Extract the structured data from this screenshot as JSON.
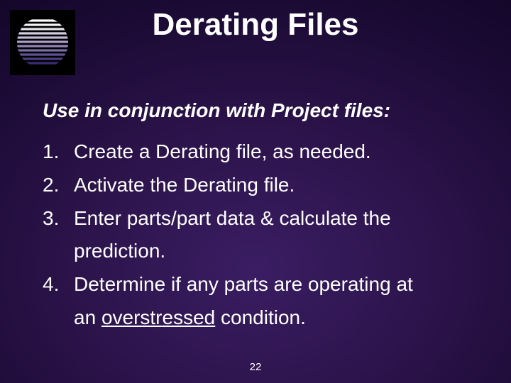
{
  "title": "Derating Files",
  "lead": "Use in conjunction with Project files:",
  "items": [
    {
      "num": "1.",
      "text": "Create a Derating file, as needed."
    },
    {
      "num": "2.",
      "text": "Activate the Derating file."
    },
    {
      "num": "3.",
      "text_a": "Enter parts/part data & calculate the",
      "text_b": "prediction."
    },
    {
      "num": "4.",
      "text_a": "Determine if any parts are operating at",
      "text_b_pre": "an ",
      "text_b_u": "overstressed",
      "text_b_post": " condition."
    }
  ],
  "page_number": "22",
  "logo_icon": "sphere-lines-icon"
}
